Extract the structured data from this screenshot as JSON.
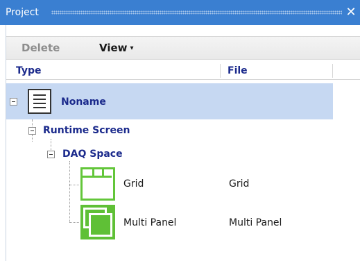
{
  "window": {
    "title": "Project",
    "close_glyph": "✕"
  },
  "toolbar": {
    "delete_label": "Delete",
    "view_label": "View",
    "view_caret": "▾"
  },
  "columns": [
    {
      "label": "Type"
    },
    {
      "label": "File"
    }
  ],
  "tree": {
    "root": {
      "label": "Noname",
      "icon": "document-list-icon",
      "selected": true
    },
    "runtime": {
      "label": "Runtime Screen"
    },
    "daq": {
      "label": "DAQ Space"
    },
    "items": [
      {
        "label": "Grid",
        "file": "Grid",
        "icon": "grid-icon"
      },
      {
        "label": "Multi Panel",
        "file": "Multi Panel",
        "icon": "multi-panel-icon"
      }
    ]
  },
  "colors": {
    "titlebar": "#3a7fd1",
    "selection": "#c6d8f2",
    "node_text": "#1b2a8c",
    "icon_green": "#63c63a"
  }
}
